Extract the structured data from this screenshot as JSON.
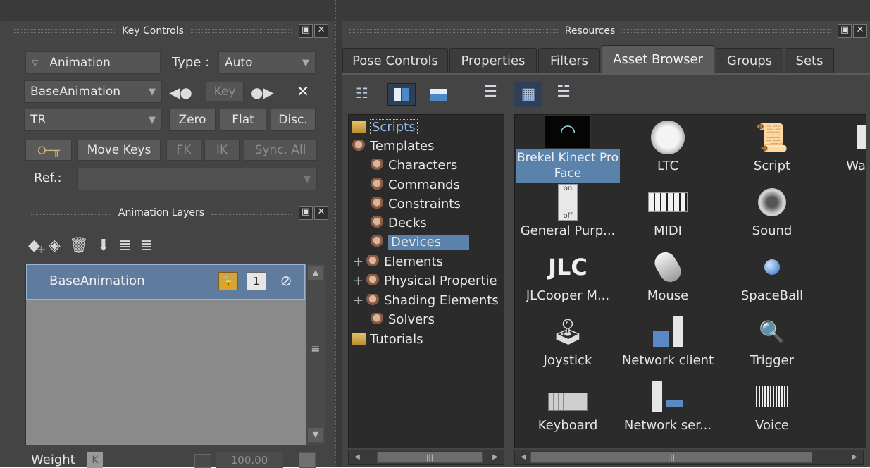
{
  "key_controls": {
    "title": "Key Controls",
    "animation_dropdown": "Animation",
    "type_label": "Type :",
    "type_value": "Auto",
    "base_animation_value": "BaseAnimation",
    "key_label": "Key",
    "tr_value": "TR",
    "zero_label": "Zero",
    "flat_label": "Flat",
    "disc_label": "Disc.",
    "move_keys_label": "Move Keys",
    "fk_label": "FK",
    "ik_label": "IK",
    "sync_all_label": "Sync. All",
    "ref_label": "Ref.:"
  },
  "animation_layers": {
    "title": "Animation Layers",
    "layer_name": "BaseAnimation",
    "layer_badge": "1",
    "weight_label": "Weight",
    "weight_k": "K",
    "weight_value": "100.00"
  },
  "resources": {
    "title": "Resources",
    "tabs": [
      {
        "label": "Pose Controls"
      },
      {
        "label": "Properties"
      },
      {
        "label": "Filters"
      },
      {
        "label": "Asset Browser"
      },
      {
        "label": "Groups"
      },
      {
        "label": "Sets"
      }
    ],
    "tree": [
      {
        "label": "Scripts"
      },
      {
        "label": "Templates"
      },
      {
        "label": "Characters"
      },
      {
        "label": "Commands"
      },
      {
        "label": "Constraints"
      },
      {
        "label": "Decks"
      },
      {
        "label": "Devices"
      },
      {
        "label": "Elements"
      },
      {
        "label": "Physical Propertie"
      },
      {
        "label": "Shading Elements"
      },
      {
        "label": "Solvers"
      },
      {
        "label": "Tutorials"
      }
    ],
    "assets": [
      {
        "label": "Brekel Kinect Pro Face"
      },
      {
        "label": "LTC"
      },
      {
        "label": "Script"
      },
      {
        "label": "Wacoı"
      },
      {
        "label": "General Purp..."
      },
      {
        "label": "MIDI"
      },
      {
        "label": "Sound"
      },
      {
        "label": "JLCooper M..."
      },
      {
        "label": "Mouse"
      },
      {
        "label": "SpaceBall"
      },
      {
        "label": "Joystick"
      },
      {
        "label": "Network client"
      },
      {
        "label": "Trigger"
      },
      {
        "label": "Keyboard"
      },
      {
        "label": "Network ser..."
      },
      {
        "label": "Voice"
      }
    ],
    "jlc_logo": "JLC",
    "switch_on": "on",
    "switch_off": "off"
  },
  "colors": {
    "panel": "#444444",
    "dark": "#2b2b2b",
    "selection": "#5a82aa",
    "layer_row": "#5f7c9e"
  },
  "icons": [
    "key-icon",
    "play-back-icon",
    "play-forward-icon",
    "close-icon",
    "add-layer-icon",
    "layer-icon",
    "trash-icon",
    "merge-icon",
    "stack-icon",
    "tree-view-icon",
    "split-vertical-icon",
    "split-horizontal-icon",
    "list-view-icon",
    "icon-view-icon",
    "detail-view-icon",
    "lock-icon",
    "mute-icon"
  ]
}
